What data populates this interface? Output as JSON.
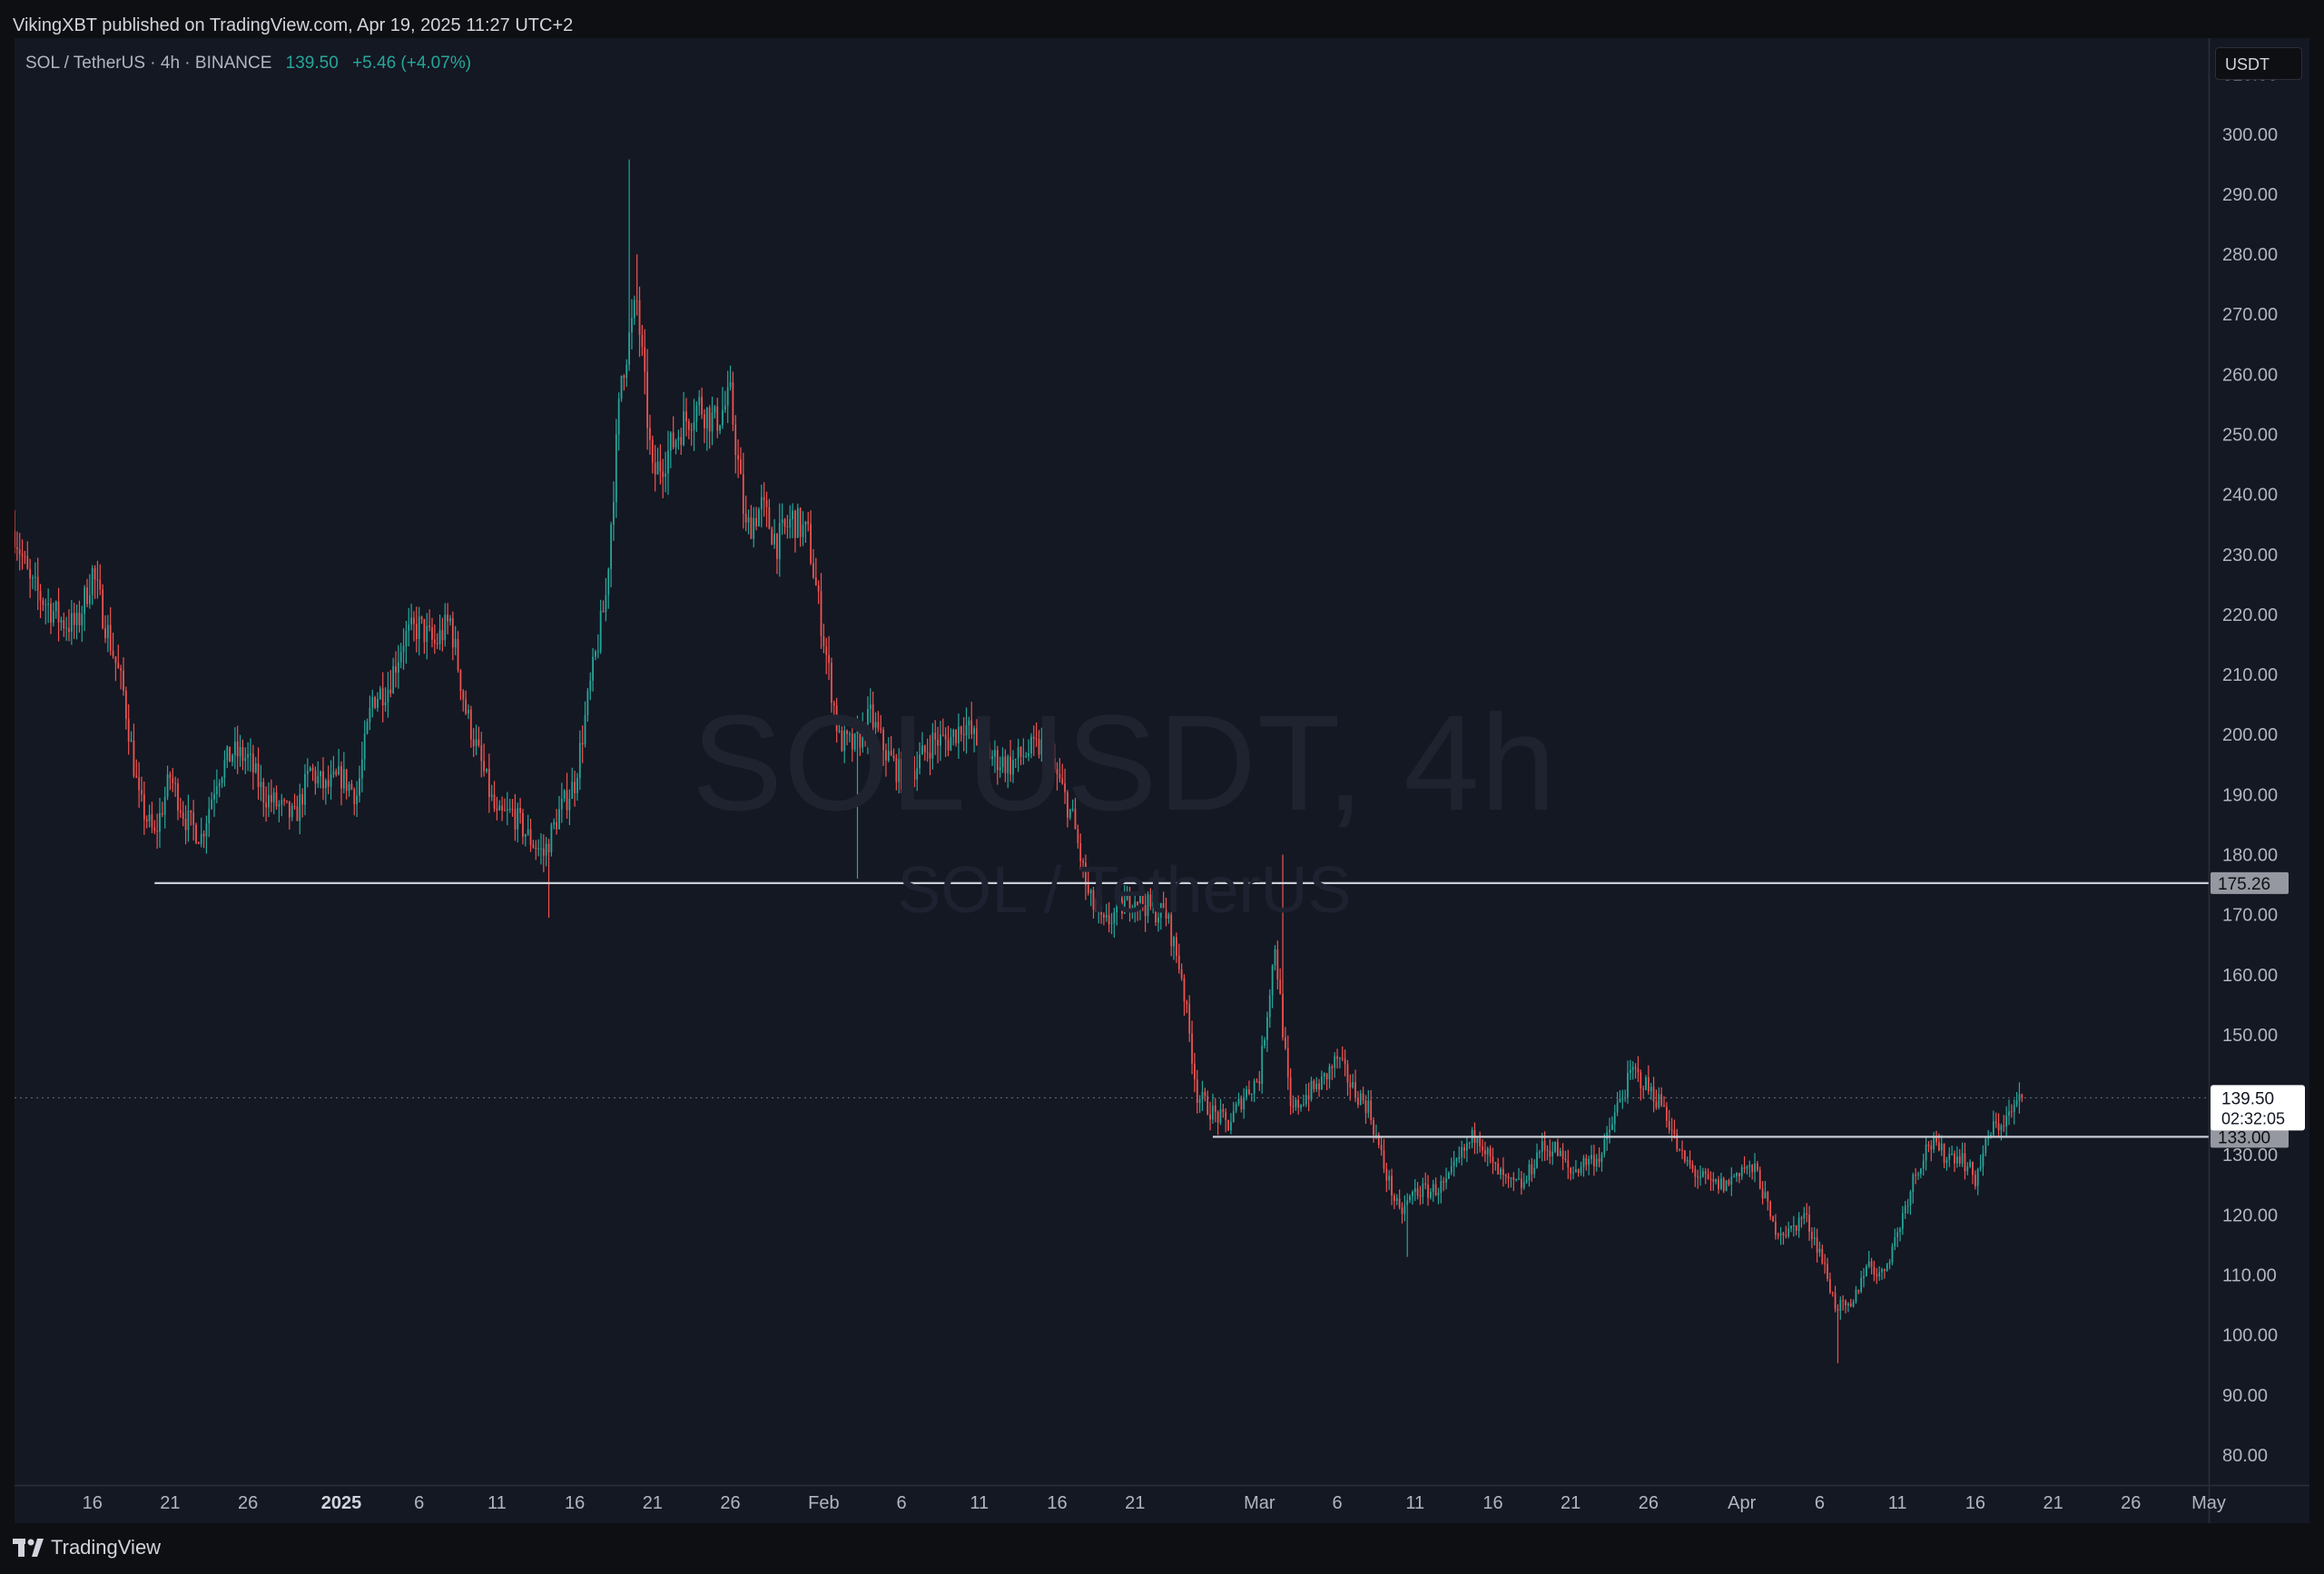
{
  "header": {
    "published_text": "VikingXBT published on TradingView.com, Apr 19, 2025 11:27 UTC+2"
  },
  "legend": {
    "symbol_text": "SOL / TetherUS · 4h · BINANCE",
    "last_price": "139.50",
    "change": "+5.46 (+4.07%)"
  },
  "currency": "USDT",
  "watermark": {
    "main": "SOLUSDT, 4h",
    "sub": "SOL / TetherUS"
  },
  "footer": {
    "brand": "TradingView",
    "logo_icon": "tradingview-logo-icon"
  },
  "colors": {
    "up": "#26a69a",
    "down": "#ef5350",
    "background": "#141823",
    "hline": "#c9ccd3"
  },
  "chart_data": {
    "type": "candlestick",
    "symbol": "SOLUSDT",
    "interval": "4h",
    "exchange": "BINANCE",
    "x_range": [
      "2024-12-11",
      "2025-05-01"
    ],
    "ylim": [
      75,
      316
    ],
    "y_ticks": [
      310,
      300,
      290,
      280,
      270,
      260,
      250,
      240,
      230,
      220,
      210,
      200,
      190,
      180,
      170,
      160,
      150,
      140,
      130,
      120,
      110,
      100,
      90,
      80
    ],
    "y_tick_labels": [
      "310.00",
      "300.00",
      "290.00",
      "280.00",
      "270.00",
      "260.00",
      "250.00",
      "240.00",
      "230.00",
      "220.00",
      "210.00",
      "200.00",
      "190.00",
      "180.00",
      "170.00",
      "160.00",
      "150.00",
      "140.00",
      "130.00",
      "120.00",
      "110.00",
      "100.00",
      "90.00",
      "80.00"
    ],
    "x_ticks": [
      {
        "label": "16",
        "date": "2024-12-16",
        "bold": false
      },
      {
        "label": "21",
        "date": "2024-12-21",
        "bold": false
      },
      {
        "label": "26",
        "date": "2024-12-26",
        "bold": false
      },
      {
        "label": "2025",
        "date": "2025-01-01",
        "bold": true
      },
      {
        "label": "6",
        "date": "2025-01-06",
        "bold": false
      },
      {
        "label": "11",
        "date": "2025-01-11",
        "bold": false
      },
      {
        "label": "16",
        "date": "2025-01-16",
        "bold": false
      },
      {
        "label": "21",
        "date": "2025-01-21",
        "bold": false
      },
      {
        "label": "26",
        "date": "2025-01-26",
        "bold": false
      },
      {
        "label": "Feb",
        "date": "2025-02-01",
        "bold": false
      },
      {
        "label": "6",
        "date": "2025-02-06",
        "bold": false
      },
      {
        "label": "11",
        "date": "2025-02-11",
        "bold": false
      },
      {
        "label": "16",
        "date": "2025-02-16",
        "bold": false
      },
      {
        "label": "21",
        "date": "2025-02-21",
        "bold": false
      },
      {
        "label": "Mar",
        "date": "2025-03-01",
        "bold": false
      },
      {
        "label": "6",
        "date": "2025-03-06",
        "bold": false
      },
      {
        "label": "11",
        "date": "2025-03-11",
        "bold": false
      },
      {
        "label": "16",
        "date": "2025-03-16",
        "bold": false
      },
      {
        "label": "21",
        "date": "2025-03-21",
        "bold": false
      },
      {
        "label": "26",
        "date": "2025-03-26",
        "bold": false
      },
      {
        "label": "Apr",
        "date": "2025-04-01",
        "bold": false
      },
      {
        "label": "6",
        "date": "2025-04-06",
        "bold": false
      },
      {
        "label": "11",
        "date": "2025-04-11",
        "bold": false
      },
      {
        "label": "16",
        "date": "2025-04-16",
        "bold": false
      },
      {
        "label": "21",
        "date": "2025-04-21",
        "bold": false
      },
      {
        "label": "26",
        "date": "2025-04-26",
        "bold": false
      },
      {
        "label": "May",
        "date": "2025-05-01",
        "bold": false
      }
    ],
    "price_path": [
      [
        "2024-12-11",
        234
      ],
      [
        "2024-12-12",
        225
      ],
      [
        "2024-12-13",
        222
      ],
      [
        "2024-12-14",
        219
      ],
      [
        "2024-12-15",
        218
      ],
      [
        "2024-12-16",
        227
      ],
      [
        "2024-12-17",
        217
      ],
      [
        "2024-12-18",
        207
      ],
      [
        "2024-12-19",
        189
      ],
      [
        "2024-12-20",
        183
      ],
      [
        "2024-12-21",
        193
      ],
      [
        "2024-12-22",
        186
      ],
      [
        "2024-12-23",
        183
      ],
      [
        "2024-12-24",
        193
      ],
      [
        "2024-12-25",
        197
      ],
      [
        "2024-12-26",
        196
      ],
      [
        "2024-12-27",
        190
      ],
      [
        "2024-12-28",
        188
      ],
      [
        "2024-12-29",
        186
      ],
      [
        "2024-12-30",
        194
      ],
      [
        "2024-12-31",
        191
      ],
      [
        "2025-01-01",
        193
      ],
      [
        "2025-01-02",
        190
      ],
      [
        "2025-01-03",
        206
      ],
      [
        "2025-01-04",
        208
      ],
      [
        "2025-01-05",
        216
      ],
      [
        "2025-01-06",
        218
      ],
      [
        "2025-01-07",
        215
      ],
      [
        "2025-01-08",
        219
      ],
      [
        "2025-01-09",
        204
      ],
      [
        "2025-01-10",
        195
      ],
      [
        "2025-01-11",
        186
      ],
      [
        "2025-01-12",
        187
      ],
      [
        "2025-01-13",
        183
      ],
      [
        "2025-01-14",
        180
      ],
      [
        "2025-01-15",
        187
      ],
      [
        "2025-01-16",
        192
      ],
      [
        "2025-01-17",
        208
      ],
      [
        "2025-01-18",
        223
      ],
      [
        "2025-01-19",
        260
      ],
      [
        "2025-01-20",
        272
      ],
      [
        "2025-01-21",
        243
      ],
      [
        "2025-01-22",
        247
      ],
      [
        "2025-01-23",
        252
      ],
      [
        "2025-01-24",
        255
      ],
      [
        "2025-01-25",
        252
      ],
      [
        "2025-01-26",
        256
      ],
      [
        "2025-01-27",
        234
      ],
      [
        "2025-01-28",
        238
      ],
      [
        "2025-01-29",
        232
      ],
      [
        "2025-01-30",
        236
      ],
      [
        "2025-01-31",
        233
      ],
      [
        "2025-02-01",
        216
      ],
      [
        "2025-02-02",
        199
      ],
      [
        "2025-02-03",
        198
      ],
      [
        "2025-02-04",
        203
      ],
      [
        "2025-02-05",
        197
      ],
      [
        "2025-02-06",
        193
      ],
      [
        "2025-02-07",
        195
      ],
      [
        "2025-02-08",
        199
      ],
      [
        "2025-02-09",
        199
      ],
      [
        "2025-02-10",
        202
      ],
      [
        "2025-02-11",
        198
      ],
      [
        "2025-02-12",
        196
      ],
      [
        "2025-02-13",
        195
      ],
      [
        "2025-02-14",
        197
      ],
      [
        "2025-02-15",
        198
      ],
      [
        "2025-02-16",
        193
      ],
      [
        "2025-02-17",
        186
      ],
      [
        "2025-02-18",
        173
      ],
      [
        "2025-02-19",
        168
      ],
      [
        "2025-02-20",
        171
      ],
      [
        "2025-02-21",
        173
      ],
      [
        "2025-02-22",
        171
      ],
      [
        "2025-02-23",
        170
      ],
      [
        "2025-02-24",
        160
      ],
      [
        "2025-02-25",
        140
      ],
      [
        "2025-02-26",
        137
      ],
      [
        "2025-02-27",
        135
      ],
      [
        "2025-02-28",
        140
      ],
      [
        "2025-03-01",
        143
      ],
      [
        "2025-03-02",
        165
      ],
      [
        "2025-03-03",
        137
      ],
      [
        "2025-03-04",
        140
      ],
      [
        "2025-03-05",
        142
      ],
      [
        "2025-03-06",
        146
      ],
      [
        "2025-03-07",
        141
      ],
      [
        "2025-03-08",
        138
      ],
      [
        "2025-03-09",
        128
      ],
      [
        "2025-03-10",
        120
      ],
      [
        "2025-03-11",
        124
      ],
      [
        "2025-03-12",
        124
      ],
      [
        "2025-03-13",
        125
      ],
      [
        "2025-03-14",
        130
      ],
      [
        "2025-03-15",
        134
      ],
      [
        "2025-03-16",
        128
      ],
      [
        "2025-03-17",
        125
      ],
      [
        "2025-03-18",
        125
      ],
      [
        "2025-03-19",
        131
      ],
      [
        "2025-03-20",
        131
      ],
      [
        "2025-03-21",
        127
      ],
      [
        "2025-03-22",
        129
      ],
      [
        "2025-03-23",
        130
      ],
      [
        "2025-03-24",
        138
      ],
      [
        "2025-03-25",
        144
      ],
      [
        "2025-03-26",
        141
      ],
      [
        "2025-03-27",
        138
      ],
      [
        "2025-03-28",
        130
      ],
      [
        "2025-03-29",
        127
      ],
      [
        "2025-03-30",
        125
      ],
      [
        "2025-03-31",
        125
      ],
      [
        "2025-04-01",
        128
      ],
      [
        "2025-04-02",
        127
      ],
      [
        "2025-04-03",
        118
      ],
      [
        "2025-04-04",
        117
      ],
      [
        "2025-04-05",
        120
      ],
      [
        "2025-04-06",
        114
      ],
      [
        "2025-04-07",
        105
      ],
      [
        "2025-04-08",
        104
      ],
      [
        "2025-04-09",
        112
      ],
      [
        "2025-04-10",
        110
      ],
      [
        "2025-04-11",
        117
      ],
      [
        "2025-04-12",
        126
      ],
      [
        "2025-04-13",
        132
      ],
      [
        "2025-04-14",
        130
      ],
      [
        "2025-04-15",
        130
      ],
      [
        "2025-04-16",
        126
      ],
      [
        "2025-04-17",
        134
      ],
      [
        "2025-04-18",
        136
      ],
      [
        "2025-04-19",
        139.5
      ]
    ],
    "horizontal_lines": [
      {
        "price": 175.26,
        "label": "175.26",
        "from_date": "2024-12-20"
      },
      {
        "price": 133.0,
        "label": "133.00",
        "from_date": "2025-02-26"
      }
    ],
    "last_price_marker": {
      "price": 139.5,
      "label": "139.50",
      "countdown": "02:32:05"
    }
  }
}
